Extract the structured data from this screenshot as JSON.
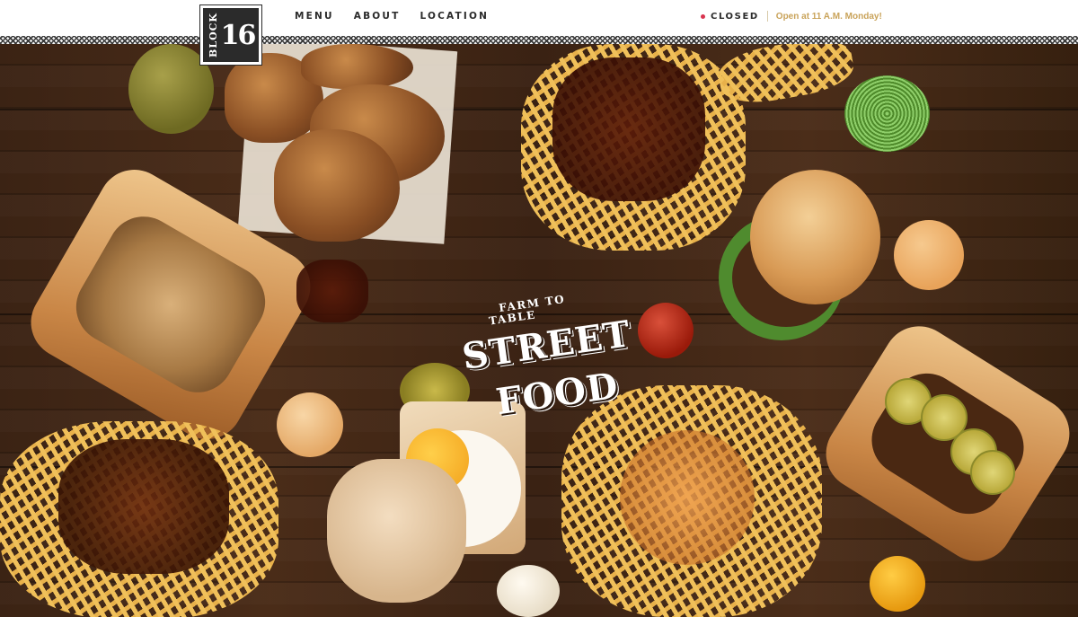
{
  "brand": {
    "logo_word": "BLOCK",
    "logo_number": "16"
  },
  "nav": {
    "items": [
      {
        "label": "MENU"
      },
      {
        "label": "ABOUT"
      },
      {
        "label": "LOCATION"
      }
    ]
  },
  "status": {
    "label": "CLOSED",
    "hours": "Open at 11 A.M. Monday!",
    "dot_color": "#d9344f",
    "hours_color": "#c9a35a"
  },
  "hero": {
    "tagline_small_1": "FARM TO",
    "tagline_small_2": "TABLE",
    "tagline_large_1": "STREET",
    "tagline_large_2": "FOOD"
  }
}
